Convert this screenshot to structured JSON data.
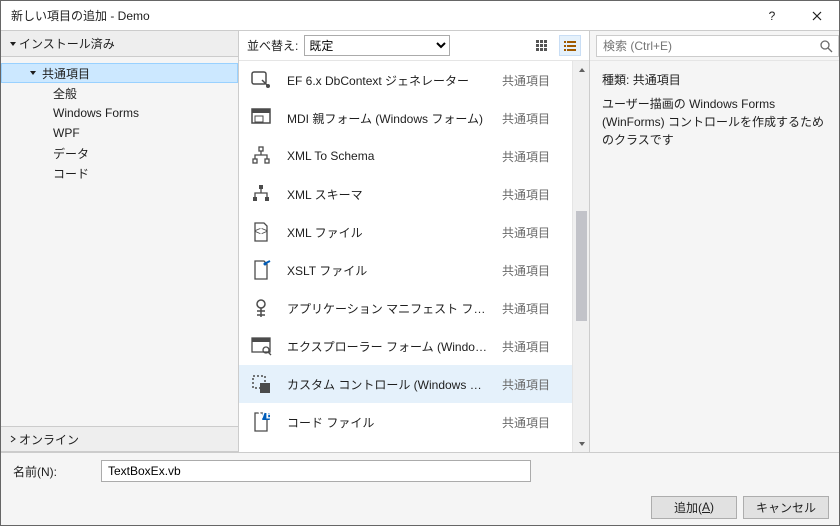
{
  "window": {
    "title": "新しい項目の追加 - Demo"
  },
  "left": {
    "installed": "インストール済み",
    "online": "オンライン",
    "tree": {
      "common": "共通項目",
      "items": [
        {
          "label": "全般"
        },
        {
          "label": "Windows Forms"
        },
        {
          "label": "WPF"
        },
        {
          "label": "データ"
        },
        {
          "label": "コード"
        }
      ]
    }
  },
  "toolbar": {
    "sort_label": "並べ替え:",
    "sort_value": "既定"
  },
  "search": {
    "placeholder": "検索 (Ctrl+E)"
  },
  "list": {
    "category": "共通項目",
    "items": [
      {
        "name": "EF 6.x DbContext ジェネレーター",
        "icon": "dbcontext"
      },
      {
        "name": "MDI 親フォーム (Windows フォーム)",
        "icon": "mdi"
      },
      {
        "name": "XML To Schema",
        "icon": "xmlschema"
      },
      {
        "name": "XML スキーマ",
        "icon": "xmlschema2"
      },
      {
        "name": "XML ファイル",
        "icon": "xmlfile"
      },
      {
        "name": "XSLT ファイル",
        "icon": "xslt"
      },
      {
        "name": "アプリケーション マニフェスト ファイル",
        "icon": "manifest"
      },
      {
        "name": "エクスプローラー フォーム (Windows フォ...",
        "icon": "explorer"
      },
      {
        "name": "カスタム コントロール (Windows フォーム)",
        "icon": "customctl",
        "selected": true
      },
      {
        "name": "コード ファイル",
        "icon": "code"
      }
    ]
  },
  "detail": {
    "kind_label": "種類:",
    "kind_value": "共通項目",
    "description": "ユーザー描画の Windows Forms (WinForms) コントロールを作成するためのクラスです"
  },
  "form": {
    "name_label": "名前(N):",
    "name_value": "TextBoxEx.vb",
    "add_label_pre": "追加(",
    "add_label_key": "A",
    "add_label_post": ")",
    "cancel_label": "キャンセル"
  }
}
